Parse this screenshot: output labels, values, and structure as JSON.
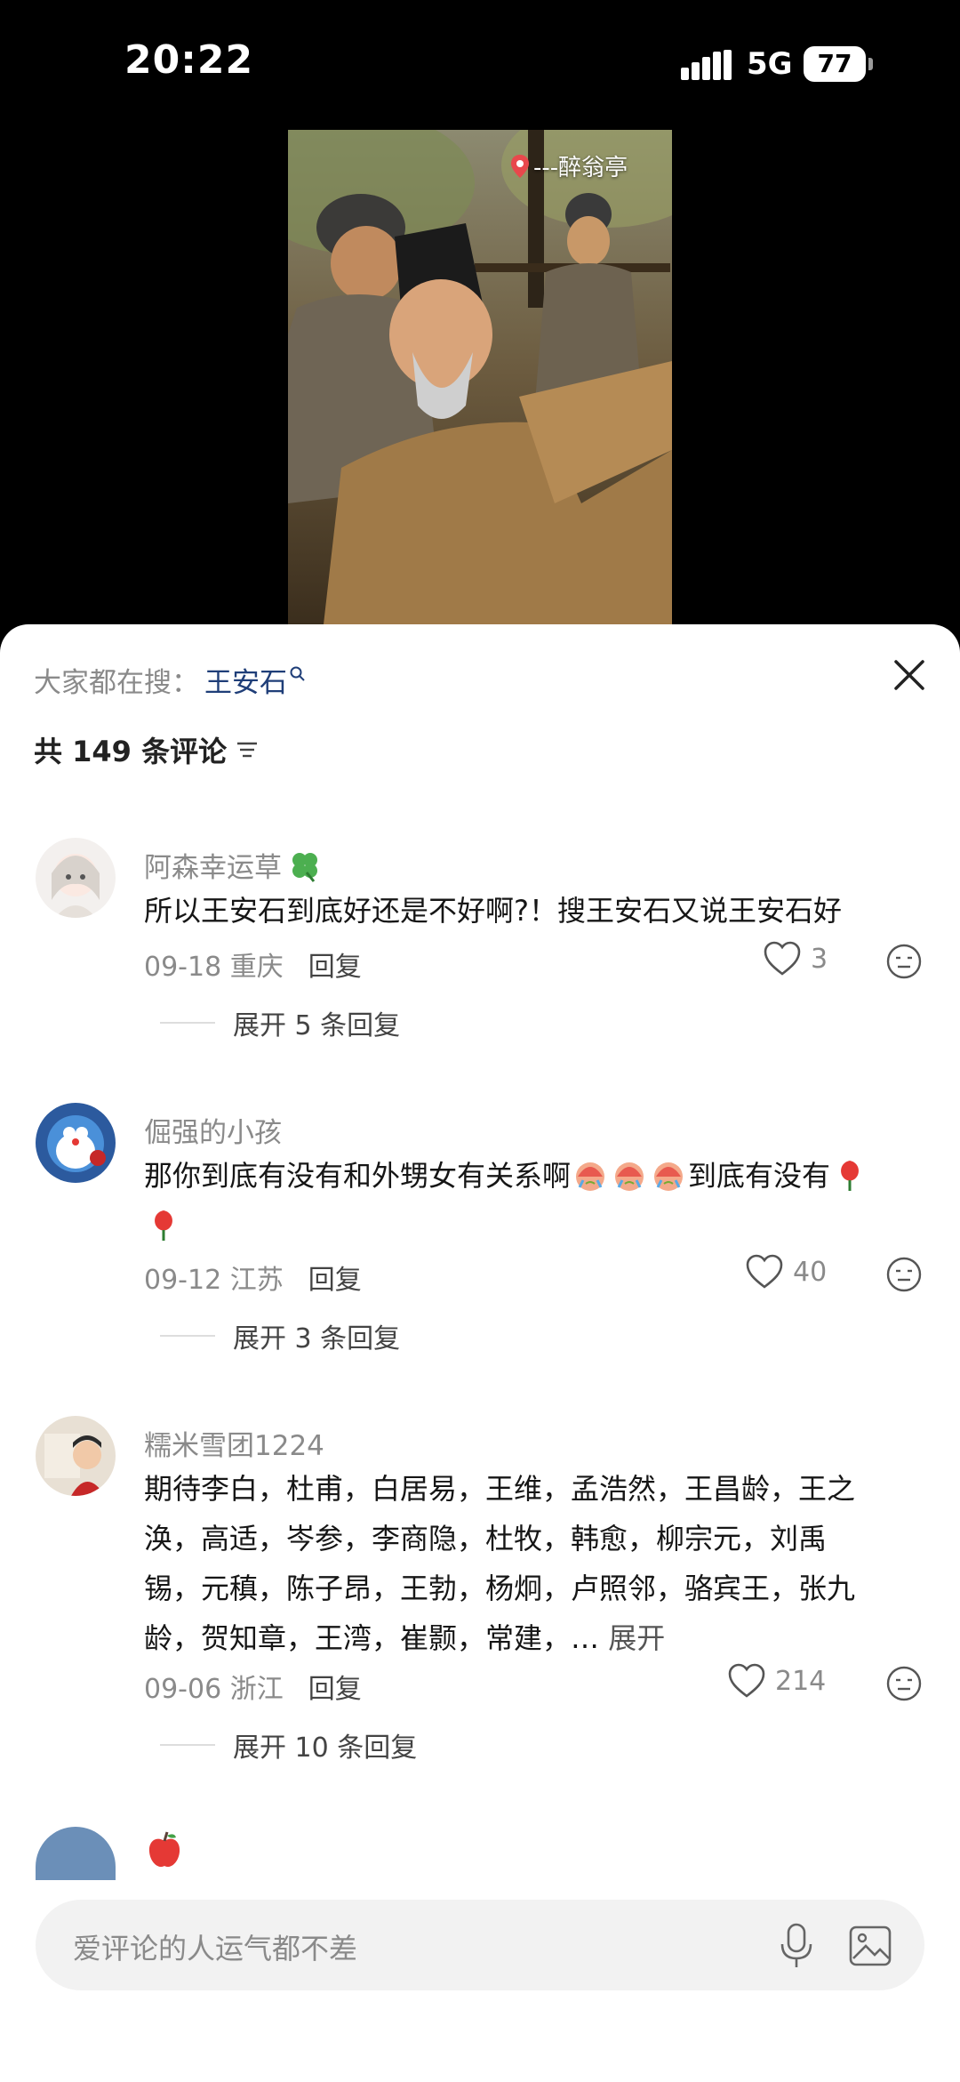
{
  "status_bar": {
    "time": "20:22",
    "network": "5G",
    "battery": "77"
  },
  "video": {
    "location": "---醉翁亭"
  },
  "comments_panel": {
    "search_prefix": "大家都在搜：",
    "search_keyword": "王安石",
    "count_text": "共 149 条评论",
    "comments": [
      {
        "username": "阿森幸运草",
        "text": "所以王安石到底好还是不好啊?！搜王安石又说王安石好",
        "date": "09-18",
        "location": "重庆",
        "reply_label": "回复",
        "likes": "3",
        "expand_label": "展开 5 条回复"
      },
      {
        "username": "倔强的小孩",
        "text": "那你到底有没有和外甥女有关系啊",
        "text_tail": "到底有没有",
        "date": "09-12",
        "location": "江苏",
        "reply_label": "回复",
        "likes": "40",
        "expand_label": "展开 3 条回复"
      },
      {
        "username": "糯米雪团1224",
        "text_lines": [
          "期待李白，杜甫，白居易，王维，孟浩然，王昌龄，王之",
          "涣，高适，岑参，李商隐，杜牧，韩愈，柳宗元，刘禹",
          "锡，元稹，陈子昂，王勃，杨炯，卢照邻，骆宾王，张九",
          "龄，贺知章，王湾，崔颢，常建，… "
        ],
        "more_label": "展开",
        "date": "09-06",
        "location": "浙江",
        "reply_label": "回复",
        "likes": "214",
        "expand_label": "展开 10 条回复"
      }
    ]
  },
  "input": {
    "placeholder": "爱评论的人运气都不差"
  },
  "colors": {
    "keyword": "#1f3e78",
    "muted": "#8a8a8a",
    "input_bg": "#f2f2f2"
  }
}
